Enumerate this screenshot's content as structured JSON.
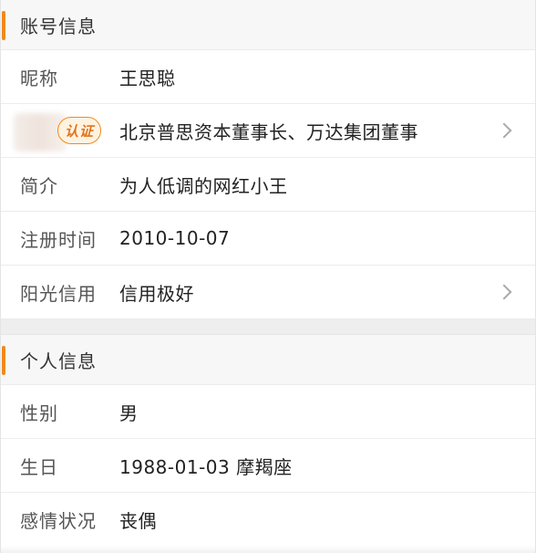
{
  "account_section": {
    "title": "账号信息",
    "rows": {
      "nickname": {
        "label": "昵称",
        "value": "王思聪"
      },
      "verification": {
        "badge": "认证",
        "value": "北京普思资本董事长、万达集团董事"
      },
      "intro": {
        "label": "简介",
        "value": "为人低调的网红小王"
      },
      "register": {
        "label": "注册时间",
        "value": "2010-10-07"
      },
      "credit": {
        "label": "阳光信用",
        "value": "信用极好"
      }
    }
  },
  "personal_section": {
    "title": "个人信息",
    "rows": {
      "gender": {
        "label": "性别",
        "value": "男"
      },
      "birthday": {
        "label": "生日",
        "value": "1988-01-03 摩羯座"
      },
      "relationship": {
        "label": "感情状况",
        "value": "丧偶"
      }
    }
  },
  "colors": {
    "accent": "#f08a1c",
    "badge_text": "#e2741d"
  },
  "icons": {
    "row_arrow": "chevron-right-icon"
  }
}
